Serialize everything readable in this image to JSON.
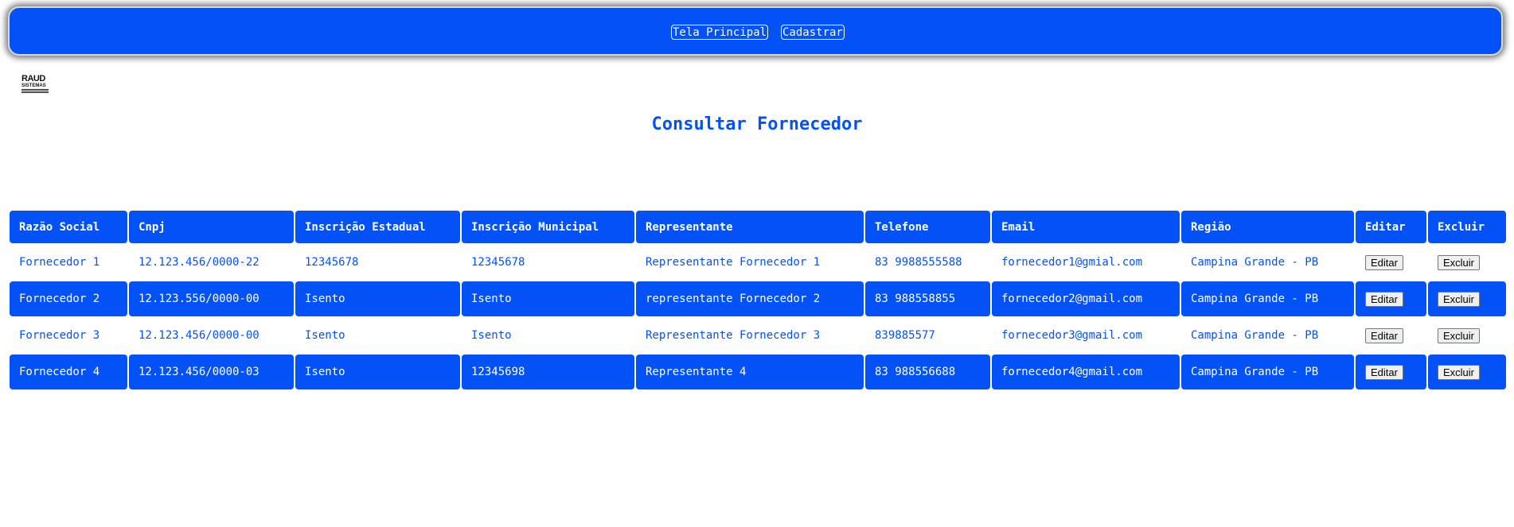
{
  "nav": {
    "home_label": "Tela Principal",
    "register_label": "Cadastrar"
  },
  "logo": {
    "line1": "RAUD",
    "line2": "SISTEMAS"
  },
  "page": {
    "title": "Consultar Fornecedor"
  },
  "colors": {
    "accent": "#0352f7",
    "row_alt": "#ffffff",
    "header_text": "#ffffff"
  },
  "table": {
    "headers": [
      "Razão Social",
      "Cnpj",
      "Inscrição Estadual",
      "Inscrição Municipal",
      "Representante",
      "Telefone",
      "Email",
      "Região",
      "Editar",
      "Excluir"
    ],
    "edit_label": "Editar",
    "delete_label": "Excluir",
    "rows": [
      [
        "Fornecedor 1",
        "12.123.456/0000-22",
        "12345678",
        "12345678",
        "Representante Fornecedor 1",
        "83 9988555588",
        "fornecedor1@gmial.com",
        "Campina Grande - PB"
      ],
      [
        "Fornecedor 2",
        "12.123.556/0000-00",
        "Isento",
        "Isento",
        "representante Fornecedor 2",
        "83 988558855",
        "fornecedor2@gmail.com",
        "Campina Grande - PB"
      ],
      [
        "Fornecedor 3",
        "12.123.456/0000-00",
        "Isento",
        "Isento",
        "Representante Fornecedor 3",
        "839885577",
        "fornecedor3@gmail.com",
        "Campina Grande - PB"
      ],
      [
        "Fornecedor 4",
        "12.123.456/0000-03",
        "Isento",
        "12345698",
        "Representante 4",
        "83 988556688",
        "fornecedor4@gmail.com",
        "Campina Grande - PB"
      ]
    ]
  }
}
